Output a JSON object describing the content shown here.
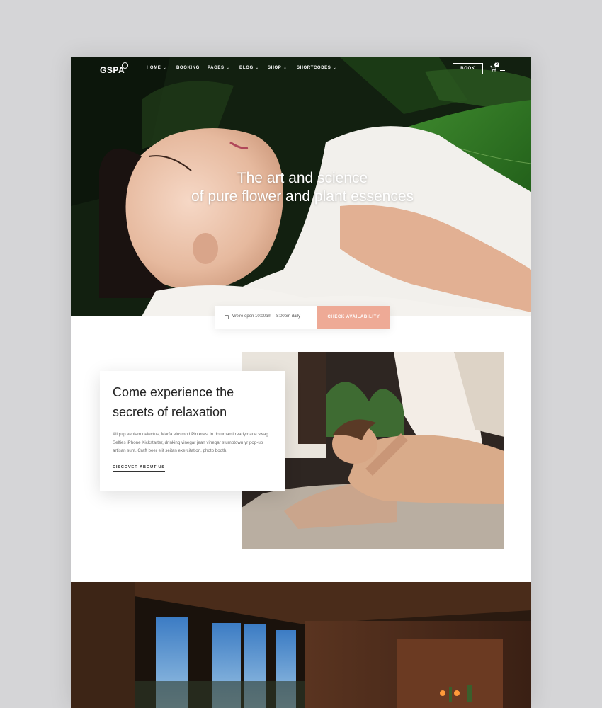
{
  "nav": {
    "logo": "GSPA",
    "items": [
      {
        "label": "HOME",
        "dropdown": true
      },
      {
        "label": "BOOKING",
        "dropdown": false
      },
      {
        "label": "PAGES",
        "dropdown": true
      },
      {
        "label": "BLOG",
        "dropdown": true
      },
      {
        "label": "SHOP",
        "dropdown": true
      },
      {
        "label": "SHORTCODES",
        "dropdown": true
      }
    ],
    "book_label": "BOOK",
    "cart_count": "0"
  },
  "hero": {
    "title_line1": "The art and science",
    "title_line2": "of pure flower and plant essences"
  },
  "booking": {
    "hours": "We're open 10:00am – 8:00pm daily",
    "cta": "CHECK AVAILABILITY"
  },
  "about": {
    "heading_line1": "Come experience the",
    "heading_line2": "secrets of relaxation",
    "body": "Aliquip veniam delectus, Marfa eiusmod Pinterest in do umami readymade swag. Selfies iPhone Kickstarter, drinking vinegar jean vinegar stumptown yr pop-up artisan sunt. Craft beer elit seitan exercitation, photo booth.",
    "link": "DISCOVER ABOUT US"
  },
  "colors": {
    "accent": "#eeaa96",
    "background": "#d5d5d7",
    "page": "#ffffff",
    "heading": "#222222"
  }
}
